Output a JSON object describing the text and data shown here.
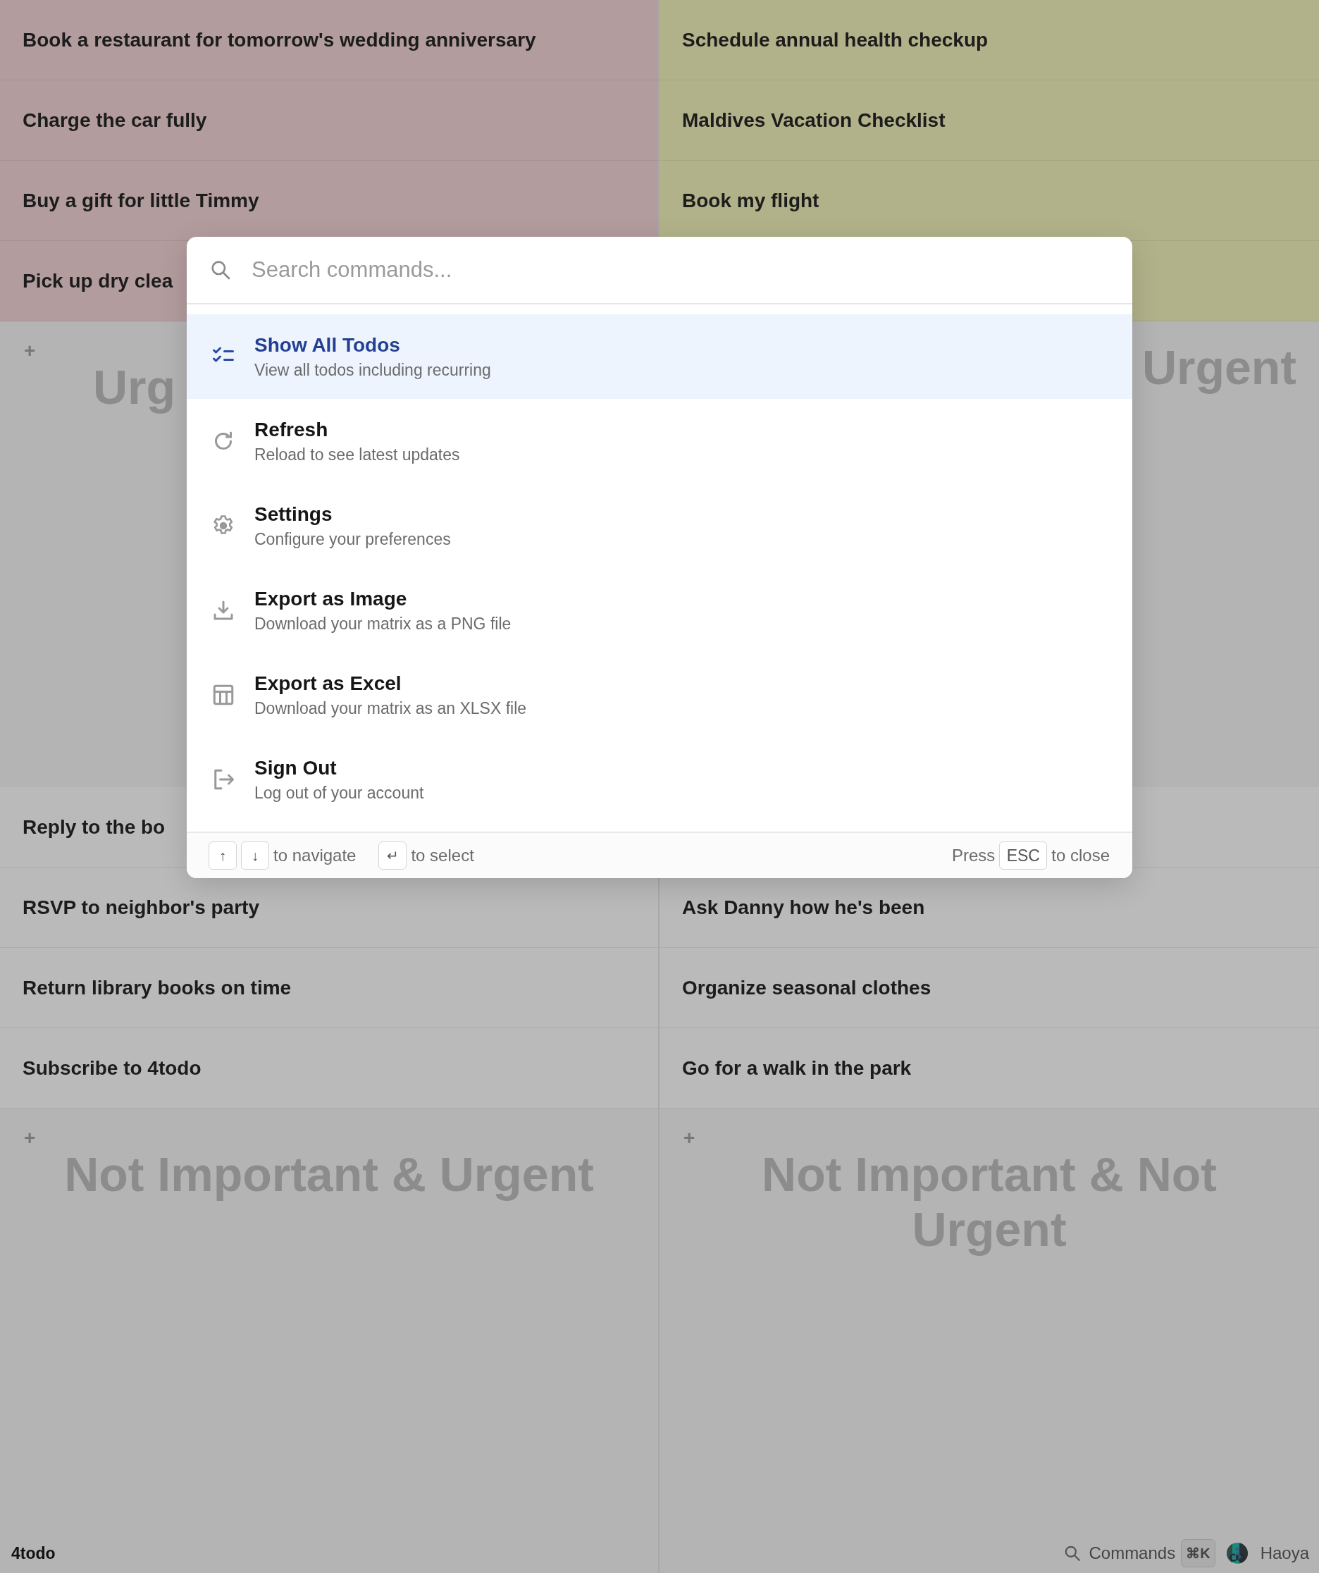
{
  "quadrants": [
    {
      "kind": "do_first",
      "color": "#b39c9e",
      "todos": [
        "Book a restaurant for tomorrow's wedding anniversary",
        "Charge the car fully",
        "Buy a gift for little Timmy",
        "Pick up dry clea"
      ],
      "add_button": "+",
      "label": "Urg"
    },
    {
      "kind": "schedule",
      "color": "#b2b28a",
      "todos": [
        "Schedule annual health checkup",
        "Maldives Vacation Checklist",
        "Book my flight"
      ],
      "label": "Urgent"
    },
    {
      "kind": "delegate",
      "color": "#bababa",
      "todos": [
        "Reply to the bo",
        "RSVP to neighbor's party",
        "Return library books on time",
        "Subscribe to 4todo"
      ],
      "add_button": "+",
      "label": "Not Important & Urgent"
    },
    {
      "kind": "eliminate",
      "color": "#bababa",
      "todos": [
        "Ask Danny how he's been",
        "Organize seasonal clothes",
        "Go for a walk in the park"
      ],
      "add_button": "+",
      "label": "Not Important & Not Urgent"
    }
  ],
  "command_palette": {
    "search": {
      "placeholder": "Search commands..."
    },
    "commands": [
      {
        "kind": "checklist",
        "title": "Show All Todos",
        "description": "View all todos including recurring",
        "selected": true
      },
      {
        "kind": "refresh",
        "title": "Refresh",
        "description": "Reload to see latest updates",
        "selected": false
      },
      {
        "kind": "gear",
        "title": "Settings",
        "description": "Configure your preferences",
        "selected": false
      },
      {
        "kind": "download",
        "title": "Export as Image",
        "description": "Download your matrix as a PNG file",
        "selected": false
      },
      {
        "kind": "table",
        "title": "Export as Excel",
        "description": "Download your matrix as an XLSX file",
        "selected": false
      },
      {
        "kind": "sign-out",
        "title": "Sign Out",
        "description": "Log out of your account",
        "selected": false
      }
    ],
    "footer": {
      "up_key": "↑",
      "down_key": "↓",
      "navigate_hint": "to navigate",
      "enter_key": "↵",
      "select_hint": "to select",
      "press_label": "Press",
      "escape_key": "ESC",
      "close_hint": "to close"
    }
  },
  "status_bar": {
    "brand": "4todo",
    "commands_label": "Commands",
    "shortcut": "⌘K",
    "user": "Haoya"
  }
}
